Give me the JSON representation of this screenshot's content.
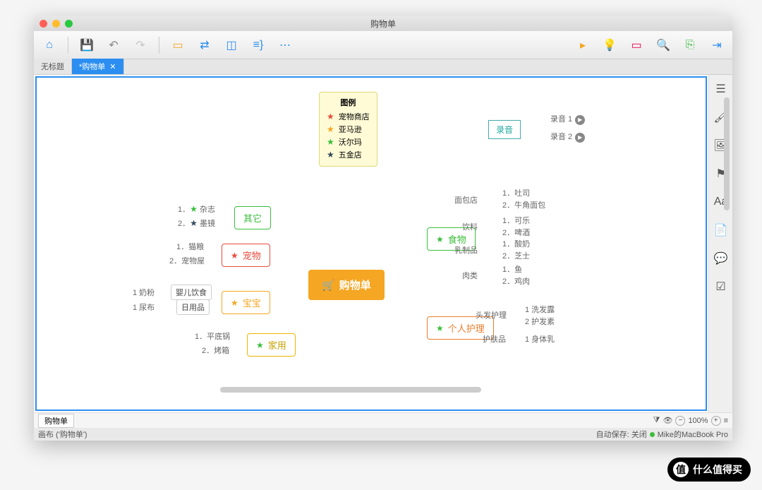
{
  "window": {
    "title": "购物单"
  },
  "tabs": {
    "untitled": "无标题",
    "active": "*购物单"
  },
  "legend": {
    "header": "图例",
    "items": [
      {
        "star": "r",
        "label": "宠物商店"
      },
      {
        "star": "o",
        "label": "亚马逊"
      },
      {
        "star": "g",
        "label": "沃尔玛"
      },
      {
        "star": "b",
        "label": "五金店"
      }
    ]
  },
  "recording": {
    "root": "录音",
    "item1": "录音 1",
    "item2": "录音 2"
  },
  "center": {
    "label": "购物单"
  },
  "branches": {
    "other": {
      "label": "其它",
      "items": [
        "1．★ 杂志",
        "2．★ 墨镜"
      ]
    },
    "pet": {
      "label": "宠物",
      "items": [
        "1．猫粮",
        "2．宠物屋"
      ]
    },
    "baby": {
      "label": "宝宝",
      "sub": [
        {
          "label": "婴儿饮食",
          "item": "1  奶粉"
        },
        {
          "label": "日用品",
          "item": "1  尿布"
        }
      ]
    },
    "home": {
      "label": "家用",
      "items": [
        "1．平底锅",
        "2．烤箱"
      ]
    },
    "food": {
      "label": "食物",
      "sub": [
        {
          "label": "面包店",
          "items": [
            "1．吐司",
            "2．牛角面包"
          ]
        },
        {
          "label": "饮料",
          "items": [
            "1．可乐",
            "2．啤酒"
          ]
        },
        {
          "label": "乳制品",
          "items": [
            "1．酸奶",
            "2．芝士"
          ]
        },
        {
          "label": "肉类",
          "items": [
            "1．鱼",
            "2．鸡肉"
          ]
        }
      ]
    },
    "care": {
      "label": "个人护理",
      "sub": [
        {
          "label": "头发护理",
          "items": [
            "1  洗发露",
            "2  护发素"
          ]
        },
        {
          "label": "护肤品",
          "items": [
            "1  身体乳"
          ]
        }
      ]
    }
  },
  "bottom": {
    "sheet": "购物单",
    "zoom": "100%"
  },
  "status": {
    "canvas": "画布 ('购物单')",
    "autosave": "自动保存: 关闭",
    "device": "Mike的MacBook Pro"
  },
  "watermark": "什么值得买"
}
